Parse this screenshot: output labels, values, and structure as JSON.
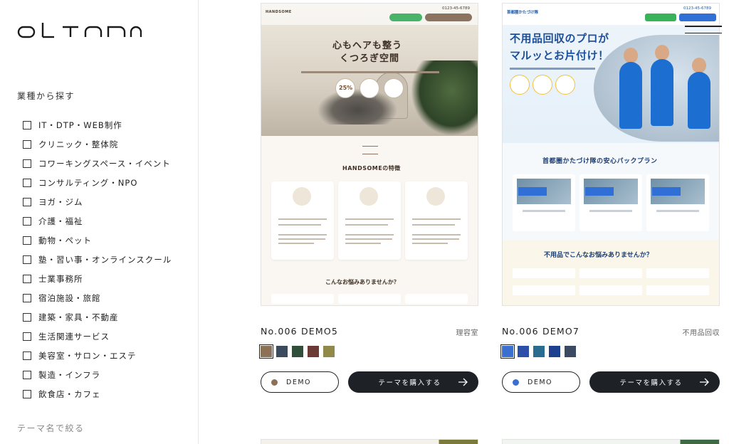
{
  "brand": {
    "logo_text": "OLTANA"
  },
  "sidebar": {
    "section_title": "業種から探す",
    "categories": [
      "IT・DTP・WEB制作",
      "クリニック・整体院",
      "コワーキングスペース・イベント",
      "コンサルティング・NPO",
      "ヨガ・ジム",
      "介護・福祉",
      "動物・ペット",
      "塾・習い事・オンラインスクール",
      "士業事務所",
      "宿泊施設・旅館",
      "建築・家具・不動産",
      "生活関連サービス",
      "美容室・サロン・エステ",
      "製造・インフラ",
      "飲食店・カフェ"
    ],
    "section_title_2": "テーマ名で絞る"
  },
  "cards": [
    {
      "title": "No.006 DEMO5",
      "category": "理容室",
      "swatches": [
        "#8c7156",
        "#3b4a5c",
        "#2f4f3a",
        "#6b3a36",
        "#8f8a4a"
      ],
      "selected_swatch": 0,
      "demo_label": "DEMO",
      "demo_dot_color": "#8c7156",
      "buy_label": "テーマを購入する",
      "thumb": {
        "brand": "HANDSOME",
        "phone": "0123-45-6789",
        "hero_line1": "心もヘアも整う",
        "hero_line2": "くつろぎ空間",
        "badge_value": "25%",
        "features_title": "HANDSOMEの特徴",
        "worries_title": "こんなお悩みありませんか？"
      }
    },
    {
      "title": "No.006 DEMO7",
      "category": "不用品回収",
      "swatches": [
        "#3a6fd0",
        "#2c4fa8",
        "#2a6d8f",
        "#1f3f8f",
        "#3a4a63"
      ],
      "selected_swatch": 0,
      "demo_label": "DEMO",
      "demo_dot_color": "#3a6fd0",
      "buy_label": "テーマを購入する",
      "thumb": {
        "brand": "首都圏かたづけ隊",
        "phone": "0123-45-6789",
        "hero_line1": "不用品回収のプロが",
        "hero_line2": "マルッとお片付け！",
        "plans_title": "首都圏かたづけ隊の安心パックプラン",
        "worries_title": "不用品でこんなお悩みありませんか？"
      }
    }
  ]
}
